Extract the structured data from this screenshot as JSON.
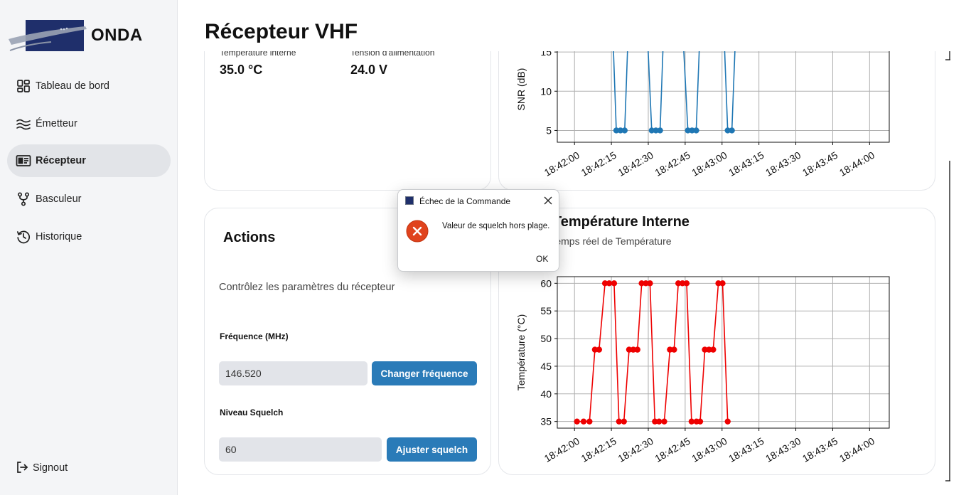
{
  "app": {
    "name": "ONDA"
  },
  "sidebar": {
    "items": [
      {
        "label": "Tableau de bord",
        "icon": "dashboard-icon"
      },
      {
        "label": "Émetteur",
        "icon": "waves-icon"
      },
      {
        "label": "Récepteur",
        "icon": "receiver-icon",
        "active": true
      },
      {
        "label": "Basculeur",
        "icon": "switch-icon"
      },
      {
        "label": "Historique",
        "icon": "history-icon"
      }
    ],
    "signout": "Signout"
  },
  "page": {
    "title": "Récepteur VHF"
  },
  "status_card": {
    "temp_label": "Température interne",
    "temp_value": "35.0 °C",
    "voltage_label": "Tension d'alimentation",
    "voltage_value": "24.0 V"
  },
  "actions": {
    "title": "Actions",
    "description": "Contrôlez les paramètres du récepteur",
    "freq_label": "Fréquence (MHz)",
    "freq_value": "146.520",
    "freq_button": "Changer fréquence",
    "squelch_label": "Niveau Squelch",
    "squelch_value": "60",
    "squelch_button": "Ajuster squelch"
  },
  "colors": {
    "accent": "#2a7bb8",
    "snr_line": "#1f77b4",
    "temp_line": "#ee0000",
    "active_nav": "#e2e4e8"
  },
  "temp_chart_header": {
    "title": "rt Température Interne",
    "subtitle": "en temps réel de Température"
  },
  "chart_data": [
    {
      "type": "line",
      "ylabel": "SNR (dB)",
      "ylim": [
        3.5,
        17
      ],
      "yticks": [
        5,
        10,
        15
      ],
      "xticks": [
        "18:42:00",
        "18:42:15",
        "18:42:30",
        "18:42:45",
        "18:43:00",
        "18:43:15",
        "18:43:30",
        "18:43:45",
        "18:44:00"
      ],
      "grid": true,
      "series": [
        {
          "points": [
            {
              "t": 15.4,
              "v": 19
            },
            {
              "t": 17.0,
              "v": 5
            },
            {
              "t": 18.7,
              "v": 5
            },
            {
              "t": 20.4,
              "v": 5
            },
            {
              "t": 22.0,
              "v": 19
            },
            {
              "t": 29.4,
              "v": 19
            },
            {
              "t": 31.4,
              "v": 5
            },
            {
              "t": 33.1,
              "v": 5
            },
            {
              "t": 34.8,
              "v": 5
            },
            {
              "t": 36.4,
              "v": 19
            },
            {
              "t": 43.8,
              "v": 19
            },
            {
              "t": 46.1,
              "v": 5
            },
            {
              "t": 47.8,
              "v": 5
            },
            {
              "t": 49.5,
              "v": 5
            },
            {
              "t": 51.2,
              "v": 19
            },
            {
              "t": 60.6,
              "v": 19
            },
            {
              "t": 62.3,
              "v": 5
            },
            {
              "t": 64.0,
              "v": 5
            },
            {
              "t": 65.7,
              "v": 19
            }
          ]
        }
      ]
    },
    {
      "type": "line",
      "ylabel": "Température (°C)",
      "ylim": [
        33.8,
        61.2
      ],
      "yticks": [
        35,
        40,
        45,
        50,
        55,
        60
      ],
      "xticks": [
        "18:42:00",
        "18:42:15",
        "18:42:30",
        "18:42:45",
        "18:43:00",
        "18:43:15",
        "18:43:30",
        "18:43:45",
        "18:44:00"
      ],
      "grid": true,
      "series": [
        {
          "points": [
            {
              "t": 1.0,
              "v": 35
            },
            {
              "t": 3.7,
              "v": 35
            },
            {
              "t": 6.1,
              "v": 35
            },
            {
              "t": 8.3,
              "v": 48
            },
            {
              "t": 10.0,
              "v": 48
            },
            {
              "t": 12.4,
              "v": 60
            },
            {
              "t": 14.1,
              "v": 60
            },
            {
              "t": 16.1,
              "v": 60
            },
            {
              "t": 18.1,
              "v": 35
            },
            {
              "t": 20.1,
              "v": 35
            },
            {
              "t": 22.2,
              "v": 48
            },
            {
              "t": 23.9,
              "v": 48
            },
            {
              "t": 25.6,
              "v": 48
            },
            {
              "t": 27.3,
              "v": 60
            },
            {
              "t": 29.0,
              "v": 60
            },
            {
              "t": 30.7,
              "v": 60
            },
            {
              "t": 32.7,
              "v": 35
            },
            {
              "t": 34.4,
              "v": 35
            },
            {
              "t": 36.5,
              "v": 35
            },
            {
              "t": 38.8,
              "v": 48
            },
            {
              "t": 40.5,
              "v": 48
            },
            {
              "t": 42.2,
              "v": 60
            },
            {
              "t": 43.9,
              "v": 60
            },
            {
              "t": 45.6,
              "v": 60
            },
            {
              "t": 47.6,
              "v": 35
            },
            {
              "t": 49.6,
              "v": 35
            },
            {
              "t": 51.1,
              "v": 35
            },
            {
              "t": 53.0,
              "v": 48
            },
            {
              "t": 54.7,
              "v": 48
            },
            {
              "t": 56.4,
              "v": 48
            },
            {
              "t": 58.5,
              "v": 60
            },
            {
              "t": 60.2,
              "v": 60
            },
            {
              "t": 62.3,
              "v": 35
            }
          ]
        }
      ]
    }
  ],
  "dialog": {
    "title": "Échec de la Commande",
    "message": "Valeur de squelch hors plage.",
    "ok": "OK"
  }
}
